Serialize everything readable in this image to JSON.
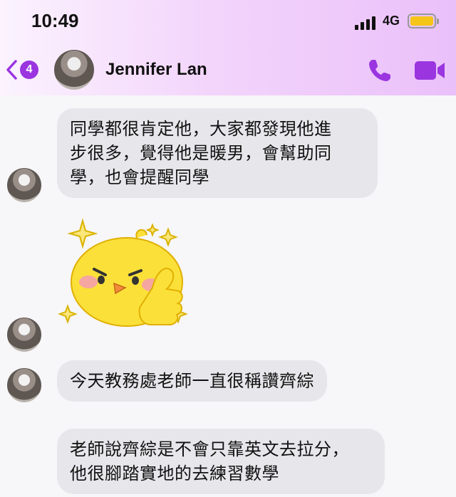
{
  "status_bar": {
    "time": "10:49",
    "network": "4G",
    "battery_level": 1.0
  },
  "header": {
    "back_badge": "4",
    "contact_name": "Jennifer Lan"
  },
  "messages": [
    {
      "type": "text",
      "text": "同學都很肯定他，大家都發現他進\n步很多，覺得他是暖男，會幫助同\n學，也會提醒同學"
    },
    {
      "type": "sticker",
      "sticker": "yellow-chick-thumbs-up-sticker"
    },
    {
      "type": "text",
      "text": "今天教務處老師一直很稱讚齊綜"
    },
    {
      "type": "text",
      "text": "老師說齊綜是不會只靠英文去拉分，\n他很腳踏實地的去練習數學"
    }
  ],
  "colors": {
    "accent": "#9a35e0",
    "bubble": "#e7e7eb",
    "sticker_yellow": "#fbe03a",
    "battery": "#f5c518"
  },
  "icons": [
    "back-chevron-icon",
    "phone-icon",
    "video-camera-icon",
    "signal-icon",
    "battery-icon"
  ]
}
